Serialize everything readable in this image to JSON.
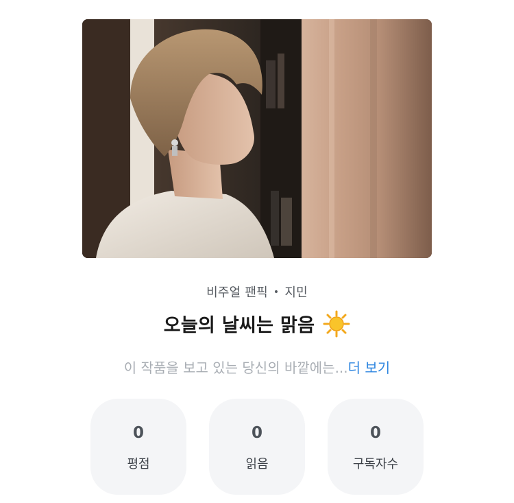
{
  "work": {
    "category": "비주얼 팬픽",
    "character": "지민",
    "separator": "•",
    "title": "오늘의 날씨는 맑음",
    "title_emoji": "sun-emoji",
    "description_preview": "이 작품을 보고 있는 당신의 바깥에는...",
    "more_label": "더 보기"
  },
  "stats": [
    {
      "value": "0",
      "label": "평점"
    },
    {
      "value": "0",
      "label": "읽음"
    },
    {
      "value": "0",
      "label": "구독자수"
    }
  ],
  "colors": {
    "link": "#2f86e0",
    "muted_text": "#a9aeb4",
    "stat_background": "#f4f5f7"
  }
}
